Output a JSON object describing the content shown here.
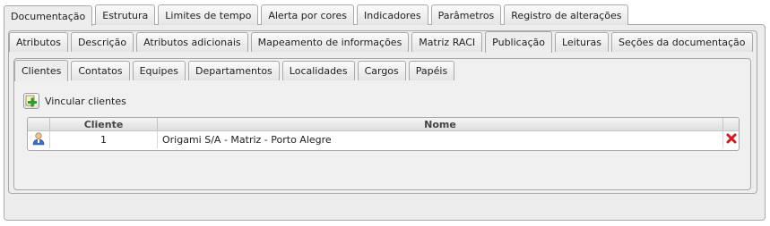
{
  "tabs_level1": [
    "Documentação",
    "Estrutura",
    "Limites de tempo",
    "Alerta por cores",
    "Indicadores",
    "Parâmetros",
    "Registro de alterações"
  ],
  "tabs_level2": [
    "Atributos",
    "Descrição",
    "Atributos adicionais",
    "Mapeamento de informações",
    "Matriz RACI",
    "Publicação",
    "Leituras",
    "Seções da documentação"
  ],
  "tabs_level3": [
    "Clientes",
    "Contatos",
    "Equipes",
    "Departamentos",
    "Localidades",
    "Cargos",
    "Papéis"
  ],
  "active": {
    "level1": "Documentação",
    "level2": "Publicação",
    "level3": "Clientes"
  },
  "toolbar": {
    "link_label": "Vincular clientes",
    "link_icon": "add-link-icon"
  },
  "grid": {
    "columns": {
      "id": "Cliente",
      "name": "Nome"
    },
    "rows": [
      {
        "icon": "user-icon",
        "id": "1",
        "name": "Origami S/A - Matriz - Porto Alegre",
        "action_icon": "delete-icon"
      }
    ]
  },
  "colors": {
    "panel_bg": "#ededed",
    "border": "#a9a9a9",
    "delete_red": "#d11a1a",
    "add_green": "#2e9b2e"
  }
}
